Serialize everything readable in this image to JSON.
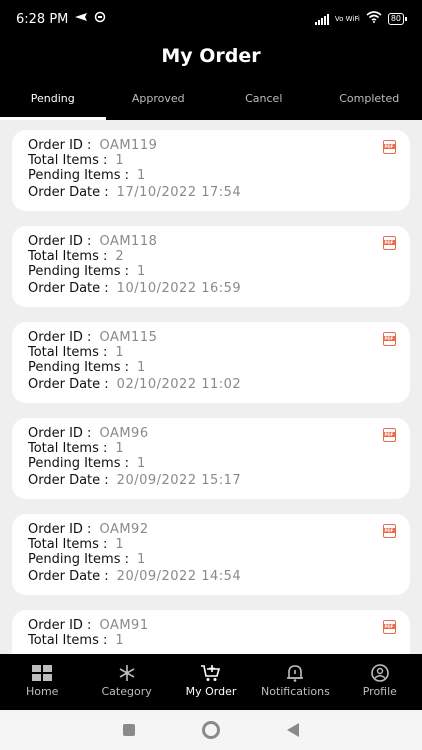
{
  "status": {
    "time": "6:28 PM",
    "network": "Vo WiFi",
    "battery": "80"
  },
  "header": {
    "title": "My Order"
  },
  "tabs": [
    {
      "label": "Pending"
    },
    {
      "label": "Approved"
    },
    {
      "label": "Cancel"
    },
    {
      "label": "Completed"
    }
  ],
  "labels": {
    "order_id": "Order ID :",
    "total_items": "Total Items :",
    "pending_items": "Pending Items :",
    "order_date": "Order Date :"
  },
  "orders": [
    {
      "id": "OAM119",
      "total": "1",
      "pending": "1",
      "date": "17/10/2022  17:54"
    },
    {
      "id": "OAM118",
      "total": "2",
      "pending": "1",
      "date": "10/10/2022  16:59"
    },
    {
      "id": "OAM115",
      "total": "1",
      "pending": "1",
      "date": "02/10/2022  11:02"
    },
    {
      "id": "OAM96",
      "total": "1",
      "pending": "1",
      "date": "20/09/2022  15:17"
    },
    {
      "id": "OAM92",
      "total": "1",
      "pending": "1",
      "date": "20/09/2022  14:54"
    },
    {
      "id": "OAM91",
      "total": "1",
      "pending": "",
      "date": ""
    }
  ],
  "nav": [
    {
      "label": "Home",
      "icon": "grid-icon"
    },
    {
      "label": "Category",
      "icon": "snowflake-icon"
    },
    {
      "label": "My Order",
      "icon": "cart-icon"
    },
    {
      "label": "Notifications",
      "icon": "bell-icon"
    },
    {
      "label": "Profile",
      "icon": "user-icon"
    }
  ],
  "colors": {
    "accent": "#e86a4a",
    "bar": "#000000"
  }
}
